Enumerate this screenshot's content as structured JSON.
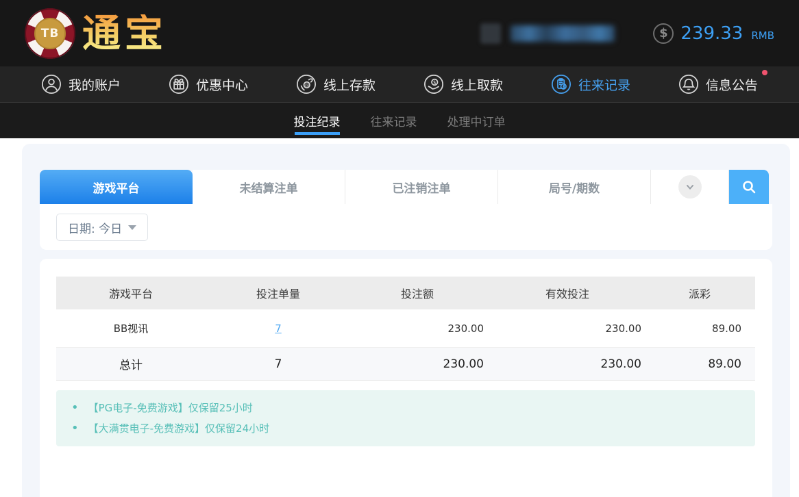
{
  "header": {
    "logo_tb": "TB",
    "brand": "通宝",
    "balance_amount": "239.33",
    "balance_currency": "RMB",
    "coin_symbol": "$"
  },
  "nav": {
    "items": [
      {
        "label": "我的账户",
        "icon": "account-icon",
        "active": false
      },
      {
        "label": "优惠中心",
        "icon": "promo-icon",
        "active": false
      },
      {
        "label": "线上存款",
        "icon": "deposit-icon",
        "active": false
      },
      {
        "label": "线上取款",
        "icon": "withdraw-icon",
        "active": false
      },
      {
        "label": "往来记录",
        "icon": "records-icon",
        "active": true
      },
      {
        "label": "信息公告",
        "icon": "notice-icon",
        "active": false,
        "badge": "unread-dot"
      }
    ]
  },
  "subnav": {
    "items": [
      {
        "label": "投注纪录",
        "active": true
      },
      {
        "label": "往来记录",
        "active": false
      },
      {
        "label": "处理中订单",
        "active": false
      }
    ]
  },
  "tabs": {
    "items": [
      {
        "label": "游戏平台",
        "active": true
      },
      {
        "label": "未结算注单",
        "active": false
      },
      {
        "label": "已注销注单",
        "active": false
      },
      {
        "label": "局号/期数",
        "active": false
      }
    ]
  },
  "filter": {
    "date_label": "日期: 今日"
  },
  "table": {
    "headers": [
      "游戏平台",
      "投注单量",
      "投注额",
      "有效投注",
      "派彩"
    ],
    "rows": [
      {
        "platform": "BB视讯",
        "count": "7",
        "bet": "230.00",
        "valid": "230.00",
        "payout": "89.00"
      }
    ],
    "total": {
      "label": "总计",
      "count": "7",
      "bet": "230.00",
      "valid": "230.00",
      "payout": "89.00"
    }
  },
  "notes": [
    "【PG电子-免费游戏】仅保留25小时",
    "【大满贯电子-免费游戏】仅保留24小时"
  ],
  "colors": {
    "accent_blue": "#3b9ff7",
    "tab_gradient_top": "#54acf5",
    "tab_gradient_bottom": "#1c80e9",
    "search_button": "#4cb0f9",
    "balance_text": "#3da0f5",
    "note_text": "#56bfb7",
    "note_bg": "#e9f6f3",
    "notice_dot": "#f0536e",
    "header_bg": "#171717",
    "nav_bg": "#242424",
    "subnav_bg": "#1b1b1b",
    "panel_bg": "#f3f6fb"
  }
}
